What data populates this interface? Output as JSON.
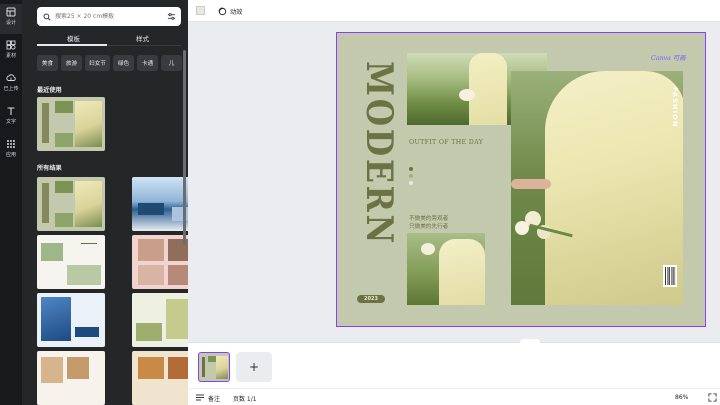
{
  "rail": {
    "items": [
      {
        "label": "设计",
        "icon": "design-icon"
      },
      {
        "label": "素材",
        "icon": "elements-icon"
      },
      {
        "label": "已上传",
        "icon": "upload-icon"
      },
      {
        "label": "文字",
        "icon": "text-icon"
      },
      {
        "label": "应用",
        "icon": "apps-icon"
      }
    ]
  },
  "panel": {
    "search_placeholder": "搜索25 × 20 cm模板",
    "tabs": [
      "模板",
      "样式"
    ],
    "chips": [
      "美食",
      "旅游",
      "妇女节",
      "绿色",
      "卡通",
      "儿"
    ],
    "recent_title": "最近使用",
    "all_results_title": "所有结果"
  },
  "topbar": {
    "animate_label": "动效",
    "swatch_color": "#e6e9dd"
  },
  "design": {
    "vertical_title": "MODERN",
    "outfit": "OUTFIT OF THE DAY",
    "cn_line1": "不做美的旁观者",
    "cn_line2": "只做美的先行者",
    "year": "2023",
    "brand": "Canva 可画",
    "fashion": "FASHION",
    "bg_color": "#c2c9ad",
    "accent_color": "#6d7244"
  },
  "bottom": {
    "add_page": "+",
    "notes_label": "备注",
    "page_count": "页数 1/1",
    "zoom": "86%"
  }
}
